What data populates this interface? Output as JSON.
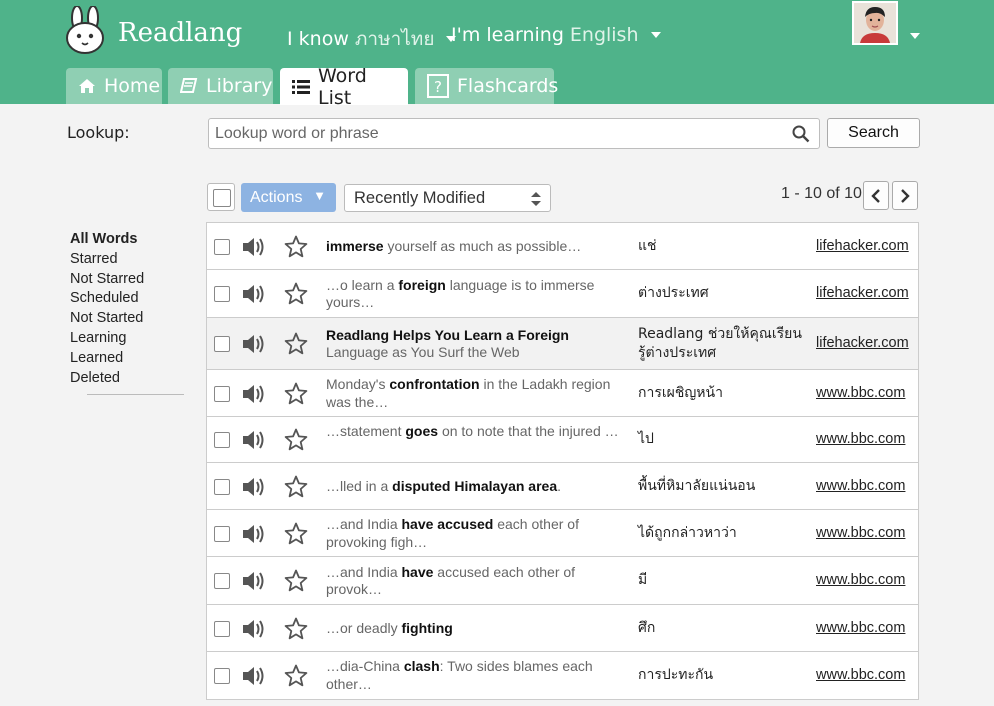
{
  "app": {
    "brand": "Readlang",
    "i_know_prefix": "I know",
    "i_know_lang": "ภาษาไทย",
    "learning_prefix": "I'm learning",
    "learning_lang": "English",
    "accent_color": "#4fb38a"
  },
  "tabs": [
    {
      "label": "Home",
      "icon": "home-icon",
      "active": false
    },
    {
      "label": "Library",
      "icon": "book-icon",
      "active": false
    },
    {
      "label": "Word List",
      "icon": "list-icon",
      "active": true
    },
    {
      "label": "Flashcards",
      "icon": "question-card-icon",
      "active": false
    }
  ],
  "lookup": {
    "label": "Lookup:",
    "placeholder": "Lookup word or phrase",
    "button": "Search"
  },
  "sidebar": {
    "items": [
      "All Words",
      "Starred",
      "Not Starred",
      "Scheduled",
      "Not Started",
      "Learning",
      "Learned",
      "Deleted"
    ],
    "active": "All Words"
  },
  "toolbar": {
    "actions_label": "Actions",
    "sort_value": "Recently Modified",
    "pager_text": "1 - 10 of 10"
  },
  "words": [
    {
      "pre": "",
      "word": "immerse",
      "post": " yourself as much as possible…",
      "translation": "แช่",
      "source": "lifehacker.com",
      "shaded": false,
      "height": 47
    },
    {
      "pre": "…o learn a ",
      "word": "foreign",
      "post": " language is to immerse yours…",
      "translation": "ต่างประเทศ",
      "source": "lifehacker.com",
      "shaded": false,
      "height": 48
    },
    {
      "pre": "",
      "word": "Readlang Helps You Learn a Foreign",
      "post": " Language as You Surf the Web",
      "translation": "Readlang ช่วยให้คุณเรียนรู้ต่างประเทศ",
      "source": "lifehacker.com",
      "shaded": true,
      "height": 52
    },
    {
      "pre": "Monday's ",
      "word": "confrontation",
      "post": " in the Ladakh region was the…",
      "translation": "การเผชิญหน้า",
      "source": "www.bbc.com",
      "shaded": false,
      "height": 47
    },
    {
      "pre": "…statement ",
      "word": "goes",
      "post": " on to note that the injured …",
      "translation": "ไป",
      "source": "www.bbc.com",
      "shaded": false,
      "height": 46
    },
    {
      "pre": "…lled in a ",
      "word": "disputed Himalayan area",
      "post": ".",
      "translation": "พื้นที่หิมาลัยแน่นอน",
      "source": "www.bbc.com",
      "shaded": false,
      "height": 47
    },
    {
      "pre": "…and India ",
      "word": "have accused",
      "post": " each other of provoking figh…",
      "translation": "ได้ถูกกล่าวหาว่า",
      "source": "www.bbc.com",
      "shaded": false,
      "height": 47
    },
    {
      "pre": "…and India ",
      "word": "have",
      "post": " accused each other of provok…",
      "translation": "มี",
      "source": "www.bbc.com",
      "shaded": false,
      "height": 48
    },
    {
      "pre": "…or deadly ",
      "word": "fighting",
      "post": "",
      "translation": "ศึก",
      "source": "www.bbc.com",
      "shaded": false,
      "height": 47
    },
    {
      "pre": "…dia-China ",
      "word": "clash",
      "post": ": Two sides blames each other…",
      "translation": "การปะทะกัน",
      "source": "www.bbc.com",
      "shaded": false,
      "height": 47
    }
  ]
}
